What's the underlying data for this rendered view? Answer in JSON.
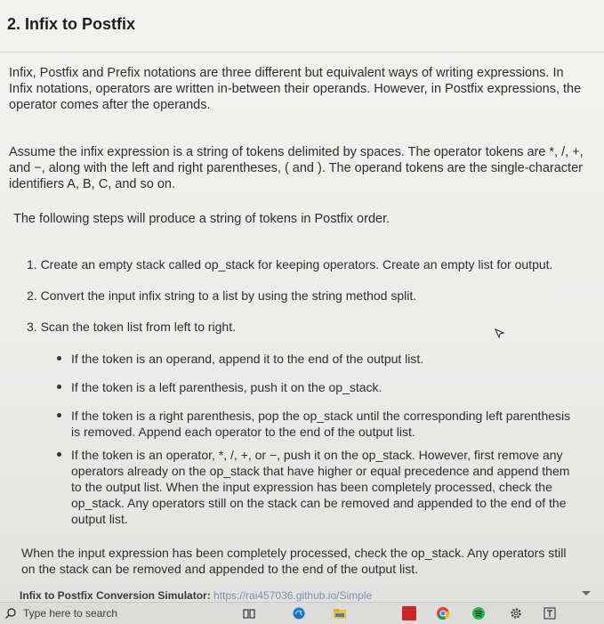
{
  "section": {
    "heading": "2. Infix to Postfix"
  },
  "paragraphs": {
    "intro": "Infix, Postfix and Prefix notations are three different but equivalent ways of writing expressions. In Infix notations, operators are written in-between their operands. However, in Postfix expressions, the operator comes after the operands.",
    "assume": "Assume the infix expression is a string of tokens delimited by spaces. The operator tokens are *, /, +, and −, along with the left and right parentheses, ( and ). The operand tokens are the single-character identifiers A, B, C, and so on.",
    "steps_intro": "The following steps will produce a string of tokens in Postfix order.",
    "closing": "When the input expression has been completely processed, check the op_stack. Any operators still on the stack can be removed and appended to the end of the output list."
  },
  "steps": [
    "1. Create an empty stack called op_stack for keeping operators. Create an empty list for output.",
    "2. Convert the input infix string to a list by using the string method split.",
    "3. Scan the token list from left to right."
  ],
  "bullets": [
    "If the token is an operand, append it to the end of the output list.",
    "If the token is a left parenthesis, push it on the op_stack.",
    "If the token is a right parenthesis, pop the op_stack until the corresponding left parenthesis is removed. Append each operator to the end of the output list.",
    "If the token is an operator, *, /, +, or −, push it on the op_stack. However, first remove any operators already on the op_stack that have higher or equal precedence and append them to the output list. When the input expression has been completely processed, check the op_stack. Any operators still on the stack can be removed and appended to the end of the output list."
  ],
  "cutoff": {
    "label": "Infix to Postfix Conversion Simulator:",
    "link": "https://rai457036.github.io/Simple"
  },
  "taskbar": {
    "search_placeholder": "Type here to search",
    "icons": [
      "task-view-icon",
      "edge-icon",
      "file-explorer-icon",
      "app-icon",
      "chrome-icon",
      "spotify-icon",
      "settings-icon",
      "app-icon-2"
    ]
  }
}
